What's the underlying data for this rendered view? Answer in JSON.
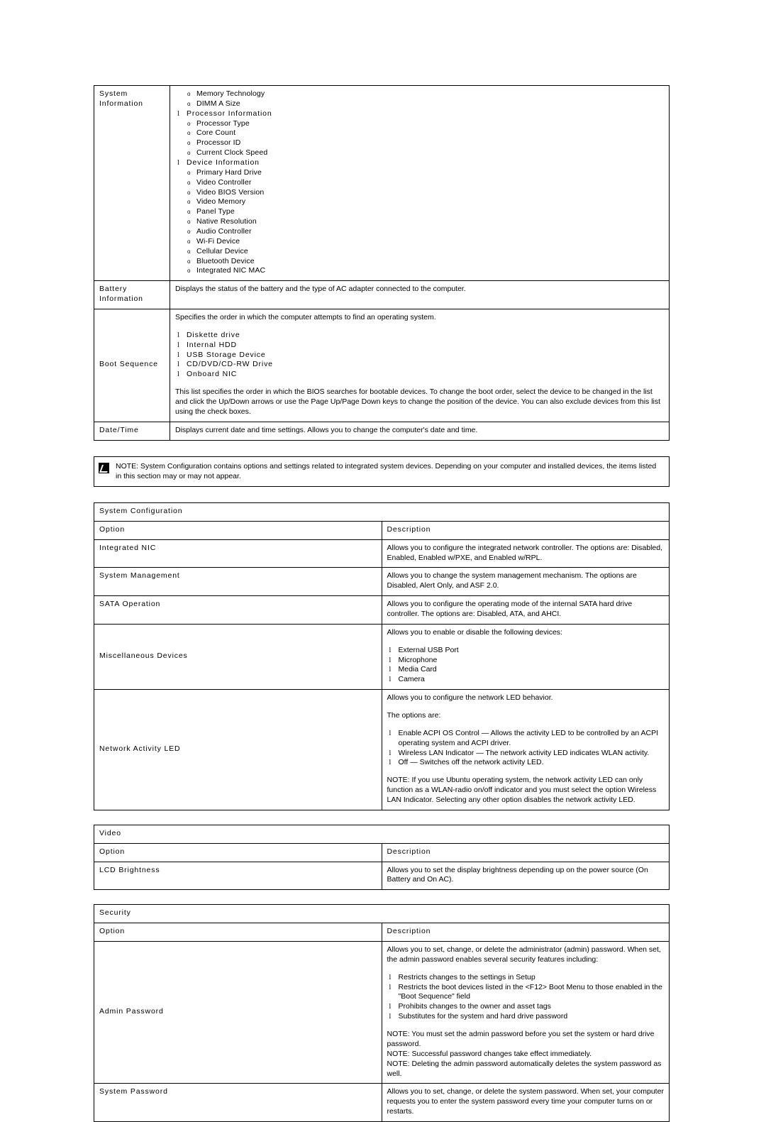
{
  "system_setup_table": {
    "rows": [
      {
        "option": "System Information",
        "lists": [
          {
            "level": 2,
            "text": "Memory Technology"
          },
          {
            "level": 2,
            "text": "DIMM A Size"
          },
          {
            "level": 1,
            "text": "Processor Information"
          },
          {
            "level": 2,
            "text": "Processor Type"
          },
          {
            "level": 2,
            "text": "Core Count"
          },
          {
            "level": 2,
            "text": "Processor ID"
          },
          {
            "level": 2,
            "text": "Current Clock Speed"
          },
          {
            "level": 1,
            "text": "Device Information"
          },
          {
            "level": 2,
            "text": "Primary Hard Drive"
          },
          {
            "level": 2,
            "text": "Video Controller"
          },
          {
            "level": 2,
            "text": "Video BIOS Version"
          },
          {
            "level": 2,
            "text": "Video Memory"
          },
          {
            "level": 2,
            "text": "Panel Type"
          },
          {
            "level": 2,
            "text": "Native Resolution"
          },
          {
            "level": 2,
            "text": "Audio Controller"
          },
          {
            "level": 2,
            "text": "Wi-Fi Device"
          },
          {
            "level": 2,
            "text": "Cellular Device"
          },
          {
            "level": 2,
            "text": "Bluetooth Device"
          },
          {
            "level": 2,
            "text": "Integrated NIC MAC"
          }
        ]
      },
      {
        "option": "Battery Information",
        "description": "Displays the status of the battery and the type of AC adapter connected to the computer."
      },
      {
        "option": "Boot Sequence",
        "intro": "Specifies the order in which the computer attempts to find an operating system.",
        "items": [
          "Diskette drive",
          "Internal HDD",
          "USB Storage Device",
          "CD/DVD/CD-RW Drive",
          "Onboard NIC"
        ],
        "outro": "This list specifies the order in which the BIOS searches for bootable devices. To change the boot order, select the device to be changed in the list and click the Up/Down arrows or use the Page Up/Page Down keys to change the position of the device. You can also exclude devices from this list using the check boxes."
      },
      {
        "option": "Date/Time",
        "description": "Displays current date and time settings. Allows you to change the computer's date and time."
      }
    ]
  },
  "note_box": {
    "icon": "note-pencil-icon",
    "text": "NOTE: System Configuration contains options and settings related to integrated system devices. Depending on your computer and installed devices, the items listed in this section may or may not appear."
  },
  "system_configuration": {
    "title": "System Configuration",
    "header_option": "Option",
    "header_description": "Description",
    "rows": [
      {
        "option": "Integrated NIC",
        "description": "Allows you to configure the integrated network controller. The options are: Disabled, Enabled, Enabled w/PXE, and Enabled w/RPL."
      },
      {
        "option": "System Management",
        "description": "Allows you to change the system management mechanism. The options are Disabled, Alert Only, and ASF 2.0."
      },
      {
        "option": "SATA Operation",
        "description": "Allows you to configure the operating mode of the internal SATA hard drive controller. The options are: Disabled, ATA, and AHCI."
      },
      {
        "option": "Miscellaneous Devices",
        "intro": "Allows you to enable or disable the following devices:",
        "items": [
          "External USB Port",
          "Microphone",
          "Media Card",
          "Camera"
        ]
      },
      {
        "option": "Network Activity LED",
        "intro": "Allows you to configure the network LED behavior.",
        "intro2": "The options are:",
        "items": [
          "Enable ACPI OS Control — Allows the activity LED to be controlled by an ACPI operating system and ACPI driver.",
          "Wireless LAN Indicator — The network activity LED indicates WLAN activity.",
          "Off — Switches off the network activity LED."
        ],
        "outro": "NOTE: If you use Ubuntu operating system, the network activity LED can only function as a WLAN-radio on/off indicator and you must select the option Wireless LAN Indicator. Selecting any other option disables the network activity LED."
      }
    ]
  },
  "video": {
    "title": "Video",
    "header_option": "Option",
    "header_description": "Description",
    "rows": [
      {
        "option": "LCD Brightness",
        "description": "Allows you to set the display brightness depending up on the power source (On Battery and On AC)."
      }
    ]
  },
  "security": {
    "title": "Security",
    "header_option": "Option",
    "header_description": "Description",
    "rows": [
      {
        "option": "Admin Password",
        "intro": "Allows you to set, change, or delete the administrator (admin) password. When set, the admin password enables several security features including:",
        "items": [
          "Restricts changes to the settings in Setup",
          "Restricts the boot devices listed in the <F12> Boot Menu to those enabled in the \"Boot Sequence\" field",
          "Prohibits changes to the owner and asset tags",
          "Substitutes for the system and hard drive password"
        ],
        "notes": [
          "NOTE: You must set the admin password before you set the system or hard drive password.",
          "NOTE: Successful password changes take effect immediately.",
          "NOTE: Deleting the admin password automatically deletes the system password as well."
        ]
      },
      {
        "option": "System Password",
        "description": "Allows you to set, change, or delete the system password. When set, your computer requests you to enter the system password every time your computer turns on or restarts."
      }
    ]
  }
}
